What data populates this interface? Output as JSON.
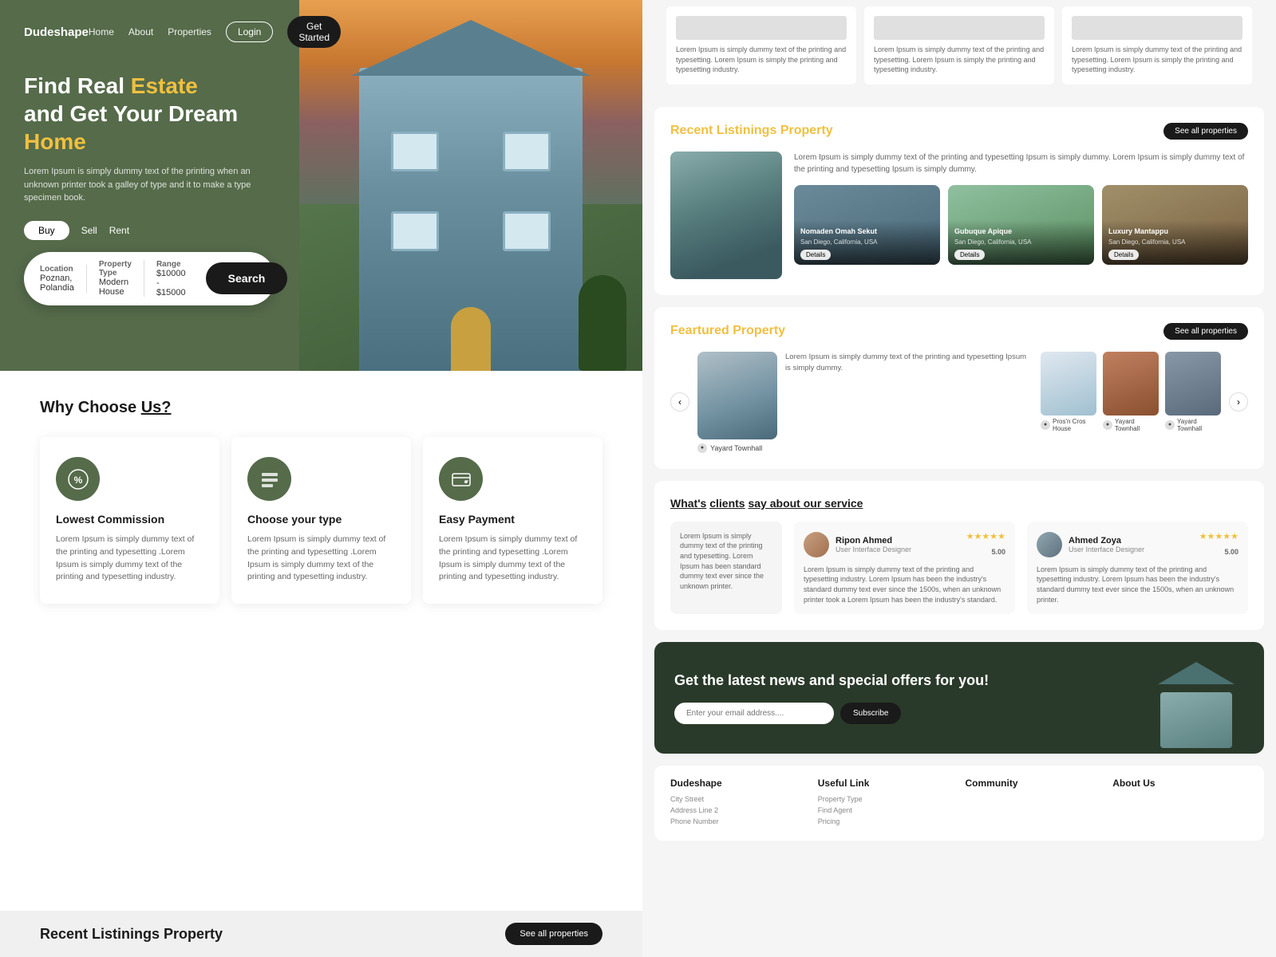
{
  "brand": {
    "name": "Dudeshape"
  },
  "nav": {
    "links": [
      "Home",
      "About",
      "Properties"
    ],
    "login": "Login",
    "get_started": "Get Started"
  },
  "hero": {
    "title_line1": "Find Real ",
    "title_accent1": "Estate",
    "title_line2": "and Get Your Dream",
    "title_accent2": "Home",
    "description": "Lorem Ipsum is simply dummy text of the printing  when an unknown printer took a galley of type and  it to make a type specimen book.",
    "tabs": [
      "Buy",
      "Sell",
      "Rent"
    ]
  },
  "search": {
    "location_label": "Location",
    "location_value": "Poznan, Polandia",
    "property_label": "Property Type",
    "property_value": "Modern House",
    "range_label": "Range",
    "range_value": "$10000 - $15000",
    "button": "Search"
  },
  "why_choose": {
    "title": "Why Choose",
    "title_underline": "Us?",
    "features": [
      {
        "title": "Lowest Commission",
        "desc": "Lorem Ipsum is simply dummy text of the printing and typesetting .Lorem Ipsum is simply dummy text of the printing and typesetting industry."
      },
      {
        "title": "Choose your type",
        "desc": "Lorem Ipsum is simply dummy text of the printing and typesetting .Lorem Ipsum is simply dummy text of the printing and typesetting industry."
      },
      {
        "title": "Easy Payment",
        "desc": "Lorem Ipsum is simply dummy text of the printing and typesetting .Lorem Ipsum is simply dummy text of the printing and typesetting industry."
      }
    ]
  },
  "bottom_strip": {
    "title": "Recent Listinings Property",
    "see_all": "See all properties"
  },
  "right_top_cards": [
    {
      "text": "Lorem Ipsum is simply dummy text of the printing and typesetting. Lorem Ipsum is simply the printing and typesetting industry."
    },
    {
      "text": "Lorem Ipsum is simply dummy text of the printing and typesetting. Lorem Ipsum is simply the printing and typesetting industry."
    },
    {
      "text": "Lorem Ipsum is simply dummy text of the printing and typesetting. Lorem Ipsum is simply the printing and typesetting industry."
    }
  ],
  "recent_listings": {
    "title": "Recent Listinings",
    "title_accent": "Property",
    "see_all": "See all properties",
    "main_desc": "Lorem Ipsum is simply dummy text of the printing and typesetting Ipsum is simply dummy. Lorem Ipsum is simply dummy text of the printing and typesetting Ipsum is simply dummy.",
    "properties": [
      {
        "name": "Nomaden Omah Sekut",
        "location": "San Diego, California, USA",
        "details": "Details"
      },
      {
        "name": "Gubuque Apique",
        "location": "San Diego, California, USA",
        "details": "Details"
      },
      {
        "name": "Luxury Mantappu",
        "location": "San Diego, California, USA",
        "details": "Details"
      }
    ]
  },
  "featured": {
    "title": "Feartured",
    "title_accent": "Property",
    "see_all": "See all properties",
    "main_desc": "Lorem Ipsum is simply dummy text of the printing and typesetting Ipsum is simply dummy.",
    "properties": [
      {
        "name": "Yayard Townhall"
      },
      {
        "name": "Pros'n Cros House"
      },
      {
        "name": "Yayard Townhall"
      },
      {
        "name": "Yayard Townhall"
      }
    ]
  },
  "testimonials": {
    "title": "What's",
    "title_underline": "clients",
    "title_end": "say about our service",
    "left_text": "Lorem Ipsum is simply dummy text of the printing and typesetting. Lorem Ipsum has been standard dummy text ever since the unknown printer.",
    "reviews": [
      {
        "name": "Ripon Ahmed",
        "role": "User Interface Designer",
        "stars": "★★★★★",
        "rating": "5.00",
        "text": "Lorem Ipsum is simply dummy text of the printing and typesetting industry. Lorem Ipsum has been the industry's standard dummy text ever since the 1500s, when an unknown printer took a Lorem Ipsum has been the industry's standard."
      },
      {
        "name": "Ahmed Zoya",
        "role": "User Interface Designer",
        "stars": "★★★★★",
        "rating": "5.00",
        "text": "Lorem Ipsum is simply dummy text of the printing and typesetting industry. Lorem Ipsum has been the industry's standard dummy text ever since the 1500s, when an unknown printer."
      }
    ]
  },
  "newsletter": {
    "title": "Get the  latest news and special offers for you!",
    "placeholder": "Enter your email address....",
    "button": "Subscribe"
  },
  "footer": {
    "cols": [
      {
        "title": "Dudeshape",
        "items": [
          "City Street",
          "Address Line 2",
          "Phone Number"
        ]
      },
      {
        "title": "Useful Link",
        "items": [
          "Property Type",
          "Find Agent",
          "Pricing"
        ]
      },
      {
        "title": "Community",
        "items": []
      },
      {
        "title": "About Us",
        "items": []
      }
    ]
  }
}
